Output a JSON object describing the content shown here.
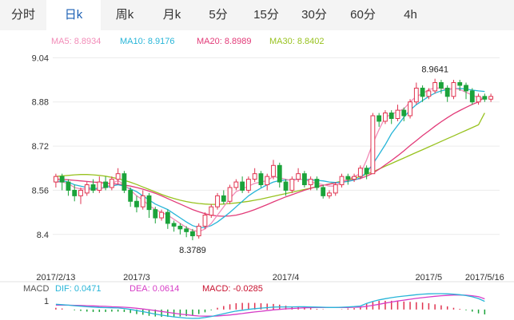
{
  "tabs": [
    {
      "label": "分时",
      "active": false
    },
    {
      "label": "日k",
      "active": true
    },
    {
      "label": "周k",
      "active": false
    },
    {
      "label": "月k",
      "active": false
    },
    {
      "label": "5分",
      "active": false
    },
    {
      "label": "15分",
      "active": false
    },
    {
      "label": "30分",
      "active": false
    },
    {
      "label": "60分",
      "active": false
    },
    {
      "label": "4h",
      "active": false
    }
  ],
  "legend": {
    "ma5": "MA5: 8.8934",
    "ma10": "MA10: 8.9176",
    "ma20": "MA20: 8.8989",
    "ma30": "MA30: 8.8402"
  },
  "macd_legend": {
    "title": "MACD",
    "dif": "DIF: 0.0471",
    "dea": "DEA: 0.0614",
    "macd": "MACD: -0.0285"
  },
  "colors": {
    "up": "#e0334f",
    "down": "#1ba33a",
    "ma5": "#f28cb8",
    "ma10": "#27b5d8",
    "ma20": "#e23a78",
    "ma30": "#98c21f",
    "dif": "#27b5d8",
    "dea": "#d63cc6",
    "macd_label": "#c8102e",
    "tab_active": "#1a5fb4"
  },
  "chart_data": {
    "type": "candlestick",
    "ylim": [
      8.33,
      9.07
    ],
    "yticks": [
      9.04,
      8.88,
      8.72,
      8.56,
      8.4
    ],
    "x_labels": [
      {
        "label": "2017/2/13",
        "index": 0
      },
      {
        "label": "2017/3",
        "index": 13
      },
      {
        "label": "2017/4",
        "index": 37
      },
      {
        "label": "2017/5",
        "index": 60
      },
      {
        "label": "2017/5/16",
        "index": 69
      }
    ],
    "annotations": [
      {
        "text": "8.9641",
        "index": 61,
        "value": 8.9641,
        "position": "above"
      },
      {
        "text": "8.3789",
        "index": 22,
        "value": 8.3789,
        "position": "below"
      }
    ],
    "candles": [
      [
        8.59,
        8.61,
        8.62,
        8.57
      ],
      [
        8.61,
        8.59,
        8.62,
        8.56
      ],
      [
        8.59,
        8.56,
        8.6,
        8.54
      ],
      [
        8.56,
        8.54,
        8.58,
        8.52
      ],
      [
        8.54,
        8.56,
        8.57,
        8.51
      ],
      [
        8.55,
        8.58,
        8.59,
        8.54
      ],
      [
        8.58,
        8.56,
        8.6,
        8.55
      ],
      [
        8.56,
        8.59,
        8.61,
        8.55
      ],
      [
        8.59,
        8.57,
        8.61,
        8.56
      ],
      [
        8.57,
        8.6,
        8.61,
        8.56
      ],
      [
        8.6,
        8.62,
        8.64,
        8.58
      ],
      [
        8.62,
        8.56,
        8.63,
        8.55
      ],
      [
        8.56,
        8.52,
        8.57,
        8.5
      ],
      [
        8.52,
        8.5,
        8.54,
        8.48
      ],
      [
        8.5,
        8.54,
        8.56,
        8.49
      ],
      [
        8.54,
        8.49,
        8.55,
        8.46
      ],
      [
        8.49,
        8.46,
        8.5,
        8.44
      ],
      [
        8.46,
        8.48,
        8.49,
        8.45
      ],
      [
        8.48,
        8.44,
        8.49,
        8.42
      ],
      [
        8.44,
        8.43,
        8.45,
        8.41
      ],
      [
        8.43,
        8.42,
        8.44,
        8.4
      ],
      [
        8.42,
        8.41,
        8.43,
        8.39
      ],
      [
        8.41,
        8.395,
        8.42,
        8.379
      ],
      [
        8.395,
        8.43,
        8.44,
        8.385
      ],
      [
        8.43,
        8.47,
        8.48,
        8.42
      ],
      [
        8.47,
        8.5,
        8.51,
        8.46
      ],
      [
        8.5,
        8.54,
        8.55,
        8.49
      ],
      [
        8.54,
        8.52,
        8.56,
        8.51
      ],
      [
        8.52,
        8.57,
        8.58,
        8.51
      ],
      [
        8.57,
        8.59,
        8.6,
        8.56
      ],
      [
        8.59,
        8.56,
        8.61,
        8.55
      ],
      [
        8.56,
        8.6,
        8.61,
        8.55
      ],
      [
        8.6,
        8.62,
        8.64,
        8.59
      ],
      [
        8.62,
        8.58,
        8.63,
        8.57
      ],
      [
        8.58,
        8.61,
        8.62,
        8.56
      ],
      [
        8.61,
        8.65,
        8.67,
        8.6
      ],
      [
        8.65,
        8.59,
        8.66,
        8.57
      ],
      [
        8.59,
        8.56,
        8.6,
        8.54
      ],
      [
        8.56,
        8.6,
        8.61,
        8.55
      ],
      [
        8.6,
        8.62,
        8.64,
        8.59
      ],
      [
        8.62,
        8.58,
        8.63,
        8.57
      ],
      [
        8.58,
        8.6,
        8.61,
        8.56
      ],
      [
        8.6,
        8.57,
        8.61,
        8.56
      ],
      [
        8.57,
        8.54,
        8.58,
        8.53
      ],
      [
        8.54,
        8.55,
        8.56,
        8.53
      ],
      [
        8.55,
        8.58,
        8.59,
        8.54
      ],
      [
        8.58,
        8.61,
        8.62,
        8.57
      ],
      [
        8.61,
        8.6,
        8.62,
        8.58
      ],
      [
        8.6,
        8.61,
        8.62,
        8.59
      ],
      [
        8.61,
        8.64,
        8.65,
        8.6
      ],
      [
        8.64,
        8.62,
        8.65,
        8.6
      ],
      [
        8.62,
        8.83,
        8.84,
        8.62
      ],
      [
        8.83,
        8.81,
        8.84,
        8.79
      ],
      [
        8.81,
        8.84,
        8.85,
        8.8
      ],
      [
        8.84,
        8.82,
        8.85,
        8.8
      ],
      [
        8.82,
        8.85,
        8.87,
        8.81
      ],
      [
        8.85,
        8.83,
        8.86,
        8.81
      ],
      [
        8.83,
        8.88,
        8.89,
        8.82
      ],
      [
        8.88,
        8.93,
        8.95,
        8.87
      ],
      [
        8.93,
        8.9,
        8.94,
        8.88
      ],
      [
        8.9,
        8.92,
        8.93,
        8.89
      ],
      [
        8.92,
        8.95,
        8.964,
        8.91
      ],
      [
        8.95,
        8.93,
        8.96,
        8.91
      ],
      [
        8.93,
        8.9,
        8.94,
        8.88
      ],
      [
        8.9,
        8.95,
        8.96,
        8.89
      ],
      [
        8.95,
        8.94,
        8.96,
        8.92
      ],
      [
        8.94,
        8.92,
        8.95,
        8.89
      ],
      [
        8.92,
        8.88,
        8.93,
        8.87
      ],
      [
        8.88,
        8.9,
        8.91,
        8.87
      ],
      [
        8.9,
        8.89,
        8.91,
        8.88
      ],
      [
        8.89,
        8.9,
        8.91,
        8.88
      ]
    ],
    "ma5": [
      8.59,
      8.59,
      8.585,
      8.57,
      8.565,
      8.565,
      8.56,
      8.565,
      8.57,
      8.585,
      8.595,
      8.58,
      8.56,
      8.54,
      8.525,
      8.505,
      8.49,
      8.48,
      8.47,
      8.455,
      8.44,
      8.425,
      8.415,
      8.41,
      8.42,
      8.44,
      8.47,
      8.5,
      8.53,
      8.555,
      8.565,
      8.575,
      8.585,
      8.59,
      8.595,
      8.61,
      8.605,
      8.6,
      8.595,
      8.6,
      8.6,
      8.59,
      8.585,
      8.58,
      8.575,
      8.575,
      8.59,
      8.6,
      8.61,
      8.62,
      8.67,
      8.73,
      8.78,
      8.825,
      8.835,
      8.845,
      8.855,
      8.88,
      8.9,
      8.91,
      8.925,
      8.93,
      8.93,
      8.925,
      8.93,
      8.925,
      8.915,
      8.905,
      8.895,
      8.893
    ],
    "ma10": [
      8.59,
      8.595,
      8.59,
      8.58,
      8.575,
      8.57,
      8.565,
      8.568,
      8.57,
      8.575,
      8.58,
      8.575,
      8.565,
      8.555,
      8.54,
      8.525,
      8.51,
      8.5,
      8.49,
      8.475,
      8.46,
      8.445,
      8.432,
      8.425,
      8.425,
      8.432,
      8.445,
      8.462,
      8.48,
      8.5,
      8.52,
      8.54,
      8.555,
      8.568,
      8.58,
      8.59,
      8.595,
      8.597,
      8.598,
      8.6,
      8.6,
      8.598,
      8.596,
      8.594,
      8.59,
      8.588,
      8.589,
      8.592,
      8.597,
      8.605,
      8.625,
      8.655,
      8.69,
      8.725,
      8.765,
      8.795,
      8.825,
      8.85,
      8.87,
      8.885,
      8.9,
      8.912,
      8.92,
      8.925,
      8.928,
      8.929,
      8.927,
      8.923,
      8.92,
      8.918
    ],
    "ma20": [
      8.6,
      8.6,
      8.598,
      8.596,
      8.594,
      8.592,
      8.59,
      8.588,
      8.586,
      8.584,
      8.582,
      8.579,
      8.575,
      8.57,
      8.564,
      8.557,
      8.549,
      8.54,
      8.53,
      8.52,
      8.51,
      8.5,
      8.49,
      8.482,
      8.475,
      8.47,
      8.467,
      8.466,
      8.467,
      8.47,
      8.475,
      8.482,
      8.49,
      8.499,
      8.508,
      8.518,
      8.527,
      8.536,
      8.544,
      8.552,
      8.56,
      8.567,
      8.573,
      8.578,
      8.582,
      8.586,
      8.59,
      8.594,
      8.598,
      8.603,
      8.611,
      8.622,
      8.636,
      8.652,
      8.668,
      8.685,
      8.703,
      8.722,
      8.74,
      8.758,
      8.775,
      8.792,
      8.808,
      8.823,
      8.837,
      8.849,
      8.86,
      8.871,
      8.88,
      8.899
    ],
    "ma30": [
      8.61,
      8.612,
      8.614,
      8.616,
      8.617,
      8.617,
      8.616,
      8.614,
      8.611,
      8.607,
      8.602,
      8.596,
      8.589,
      8.581,
      8.572,
      8.563,
      8.554,
      8.545,
      8.537,
      8.53,
      8.524,
      8.519,
      8.515,
      8.512,
      8.51,
      8.509,
      8.509,
      8.51,
      8.512,
      8.514,
      8.517,
      8.52,
      8.524,
      8.528,
      8.533,
      8.538,
      8.543,
      8.548,
      8.553,
      8.558,
      8.563,
      8.568,
      8.573,
      8.578,
      8.583,
      8.588,
      8.593,
      8.598,
      8.604,
      8.61,
      8.618,
      8.627,
      8.637,
      8.647,
      8.657,
      8.667,
      8.677,
      8.687,
      8.697,
      8.707,
      8.717,
      8.727,
      8.737,
      8.747,
      8.757,
      8.767,
      8.777,
      8.787,
      8.797,
      8.84
    ],
    "macd": {
      "dif": [
        0.03,
        0.028,
        0.025,
        0.022,
        0.019,
        0.016,
        0.014,
        0.012,
        0.011,
        0.01,
        0.009,
        0.006,
        0.001,
        -0.006,
        -0.012,
        -0.019,
        -0.026,
        -0.032,
        -0.037,
        -0.042,
        -0.046,
        -0.049,
        -0.051,
        -0.05,
        -0.046,
        -0.04,
        -0.032,
        -0.024,
        -0.016,
        -0.009,
        -0.004,
        0.001,
        0.005,
        0.008,
        0.011,
        0.014,
        0.015,
        0.015,
        0.015,
        0.016,
        0.016,
        0.015,
        0.014,
        0.013,
        0.012,
        0.012,
        0.013,
        0.015,
        0.017,
        0.02,
        0.035,
        0.046,
        0.055,
        0.062,
        0.068,
        0.073,
        0.077,
        0.081,
        0.085,
        0.088,
        0.09,
        0.091,
        0.091,
        0.09,
        0.088,
        0.085,
        0.08,
        0.073,
        0.063,
        0.047
      ],
      "dea": [
        0.025,
        0.025,
        0.025,
        0.024,
        0.023,
        0.022,
        0.021,
        0.019,
        0.018,
        0.016,
        0.015,
        0.013,
        0.011,
        0.007,
        0.003,
        -0.001,
        -0.006,
        -0.011,
        -0.016,
        -0.021,
        -0.026,
        -0.03,
        -0.034,
        -0.037,
        -0.038,
        -0.038,
        -0.037,
        -0.034,
        -0.031,
        -0.027,
        -0.023,
        -0.018,
        -0.014,
        -0.01,
        -0.006,
        -0.002,
        0.001,
        0.004,
        0.006,
        0.008,
        0.01,
        0.011,
        0.012,
        0.012,
        0.012,
        0.012,
        0.012,
        0.012,
        0.013,
        0.014,
        0.018,
        0.024,
        0.03,
        0.037,
        0.043,
        0.049,
        0.054,
        0.059,
        0.064,
        0.068,
        0.072,
        0.076,
        0.079,
        0.081,
        0.083,
        0.083,
        0.082,
        0.079,
        0.074,
        0.061
      ]
    }
  }
}
